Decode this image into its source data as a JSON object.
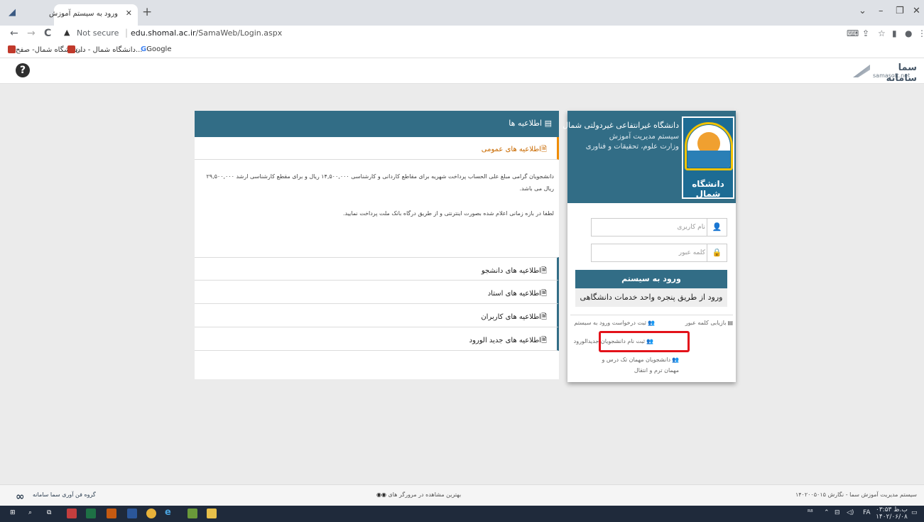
{
  "browser": {
    "tab_title": "ورود به سیستم آموزش",
    "tab_close": "✕",
    "new_tab": "+",
    "window_controls": {
      "minimize": "–",
      "maximize": "❐",
      "close": "✕",
      "menu": "⌄"
    },
    "nav": {
      "back": "←",
      "forward": "→",
      "reload": "C"
    },
    "security_label": "Not secure",
    "url_host": "edu.shomal.ac.ir",
    "url_path": "/SamaWeb/Login.aspx",
    "bookmarks": [
      {
        "label": "دانشگاه شمال- صفح..."
      },
      {
        "label": "دانشگاه شمال - دان..."
      },
      {
        "label": "Google"
      }
    ]
  },
  "header": {
    "help_glyph": "?",
    "brand_name": "سما سامانه",
    "brand_domain": "samasoft.net"
  },
  "login": {
    "university_name": "دانشگاه غیرانتفاعی غیردولتی شمال",
    "system_name": "سیستم مدیریت آموزش",
    "ministry": "وزارت علوم، تحقیقات و فناوری",
    "logo_text": "دانشگاه شمال",
    "username_placeholder": "نام کاربری",
    "password_placeholder": "کلمه عبور",
    "login_button": "ورود به سیستم",
    "portal_button": "ورود از طریق پنجره واحد خدمات دانشگاهی",
    "links": {
      "recover_password": "بازیابی کلمه عبور",
      "request_login": "ثبت درخواست ورود به سیستم",
      "new_student_signup": "ثبت نام دانشجویان جدیدالورود",
      "guest_students_1": "دانشجویان مهمان تک درس و",
      "guest_students_2": "مهمان ترم و انتقال"
    }
  },
  "announcements": {
    "title": "اطلاعیه ها",
    "tabs": {
      "general": "اطلاعیه های عمومی",
      "students": "اطلاعیه های دانشجو",
      "professors": "اطلاعیه های استاد",
      "users": "اطلاعیه های کاربران",
      "new_students": "اطلاعیه های جدید الورود"
    },
    "body_1": "دانشجویان گرامی مبلغ علی الحساب پرداخت شهریه برای مقاطع کاردانی و کارشناسی ۱۴,۵۰۰,۰۰۰ ریال و برای مقطع کارشناسی ارشد ۲۹,۵۰۰,۰۰۰ ریال می باشد.",
    "body_2": "لطفا در بازه زمانی اعلام شده بصورت اینترنتی و از طریق درگاه بانک ملت پرداخت نمایید."
  },
  "footer": {
    "company": "گروه فن آوری سما سامانه",
    "browsers_note": "بهترین مشاهده در مرورگر های",
    "version": "سیستم مدیریت آموزش سما - نگارش ۱۴۰۲۰۰۵۰۱۵"
  },
  "taskbar": {
    "clock_time": "۰۳:۵۳ ب.ظ",
    "clock_date": "۱۴۰۲/۰۶/۰۸",
    "lang": "FA"
  }
}
